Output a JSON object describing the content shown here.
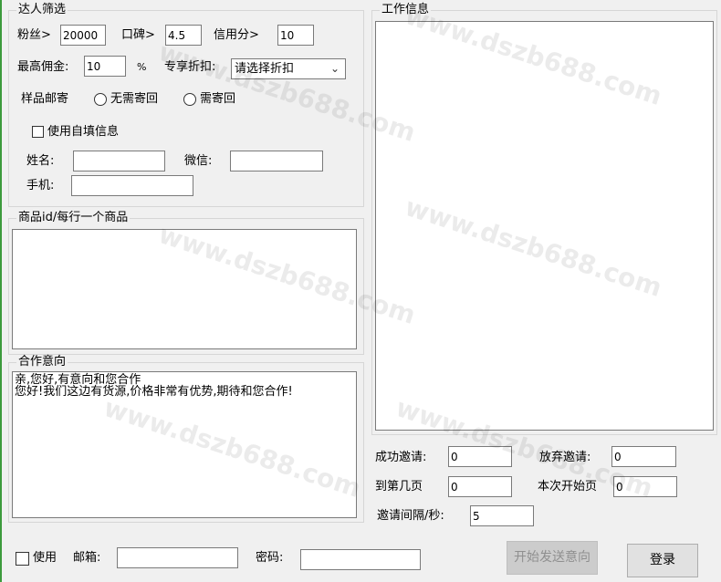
{
  "talent_filter": {
    "group_title": "达人筛选",
    "fans_label": "粉丝>",
    "fans_value": "20000",
    "reputation_label": "口碑>",
    "reputation_value": "4.5",
    "credit_label": "信用分>",
    "credit_value": "10",
    "max_commission_label": "最高佣金:",
    "max_commission_value": "10",
    "percent_sign": "%",
    "discount_label": "专享折扣:",
    "discount_selected": "请选择折扣",
    "sample_mail_label": "样品邮寄",
    "no_return_label": "无需寄回",
    "need_return_label": "需寄回",
    "use_custom_info_label": "使用自填信息",
    "name_label": "姓名:",
    "wechat_label": "微信:",
    "phone_label": "手机:"
  },
  "product_ids": {
    "group_title": "商品id/每行一个商品"
  },
  "cooperation": {
    "group_title": "合作意向",
    "text": "亲,您好,有意向和您合作\n您好!我们这边有货源,价格非常有优势,期待和您合作!"
  },
  "work_info": {
    "group_title": "工作信息"
  },
  "stats": {
    "success_label": "成功邀请:",
    "success_value": "0",
    "abandon_label": "放弃邀请:",
    "abandon_value": "0",
    "to_page_label": "到第几页",
    "to_page_value": "0",
    "start_page_label": "本次开始页",
    "start_page_value": "0",
    "interval_label": "邀请间隔/秒:",
    "interval_value": "5"
  },
  "bottom": {
    "use_label": "使用",
    "email_label": "邮箱:",
    "password_label": "密码:",
    "start_button": "开始发送意向",
    "login_button": "登录"
  },
  "watermark": "www.dszb688.com"
}
